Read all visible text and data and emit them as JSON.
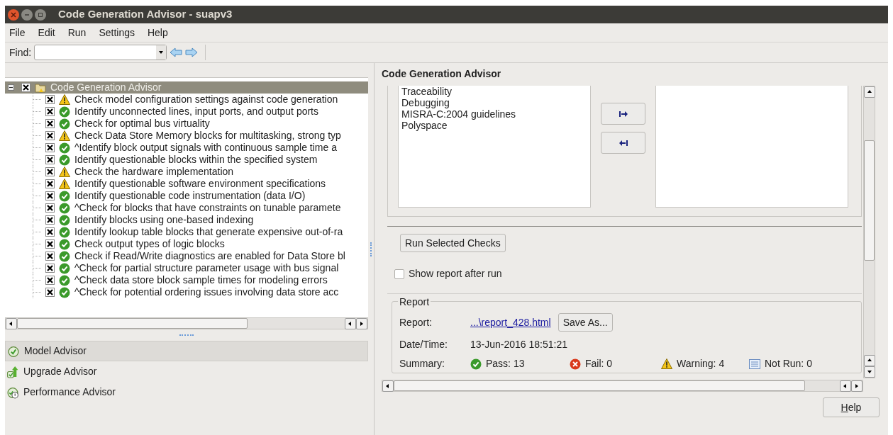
{
  "window": {
    "title": "Code Generation Advisor - suapv3"
  },
  "menu": [
    "File",
    "Edit",
    "Run",
    "Settings",
    "Help"
  ],
  "find": {
    "label": "Find:"
  },
  "tree": {
    "label": "Code Generation Advisor",
    "expanded": true,
    "checked": true,
    "selected": true,
    "children": [
      {
        "label": "Check model configuration settings against code generation",
        "kind": "warning",
        "checked": true
      },
      {
        "label": "Identify unconnected lines, input ports, and output ports",
        "kind": "pass",
        "checked": true
      },
      {
        "label": "Check for optimal bus virtuality",
        "kind": "pass",
        "checked": true
      },
      {
        "label": "Check Data Store Memory blocks for multitasking, strong typ",
        "kind": "warning",
        "checked": true
      },
      {
        "label": "^Identify block output signals with continuous sample time a",
        "kind": "pass",
        "checked": true
      },
      {
        "label": "Identify questionable blocks within the specified system",
        "kind": "pass",
        "checked": true
      },
      {
        "label": "Check the hardware implementation",
        "kind": "warning",
        "checked": true
      },
      {
        "label": "Identify questionable software environment specifications",
        "kind": "warning",
        "checked": true
      },
      {
        "label": "Identify questionable code instrumentation (data I/O)",
        "kind": "pass",
        "checked": true
      },
      {
        "label": "^Check for blocks that have constraints on tunable paramete",
        "kind": "pass",
        "checked": true
      },
      {
        "label": "Identify blocks using one-based indexing",
        "kind": "pass",
        "checked": true
      },
      {
        "label": "Identify lookup table blocks that generate expensive out-of-ra",
        "kind": "pass",
        "checked": true
      },
      {
        "label": "Check output types of logic blocks",
        "kind": "pass",
        "checked": true
      },
      {
        "label": "Check if Read/Write diagnostics are enabled for Data Store bl",
        "kind": "pass",
        "checked": true
      },
      {
        "label": "^Check for partial structure parameter usage with bus signal",
        "kind": "pass",
        "checked": true
      },
      {
        "label": "^Check data store block sample times for modeling errors",
        "kind": "pass",
        "checked": true
      },
      {
        "label": "^Check for potential ordering issues involving data store acc",
        "kind": "pass",
        "checked": true
      }
    ]
  },
  "advisors": [
    {
      "label": "Model Advisor",
      "kind": "model",
      "selected": true
    },
    {
      "label": "Upgrade Advisor",
      "kind": "upgrade",
      "selected": false
    },
    {
      "label": "Performance Advisor",
      "kind": "performance",
      "selected": false
    }
  ],
  "panel": {
    "title": "Code Generation Advisor",
    "available": [
      "Traceability",
      "Debugging",
      "MISRA-C:2004 guidelines",
      "Polyspace"
    ],
    "run_button": "Run Selected Checks",
    "show_report": {
      "label": "Show report after run",
      "checked": false
    },
    "report": {
      "group": "Report",
      "report_label": "Report:",
      "report_link": "...\\report_428.html",
      "save_as": "Save As...",
      "date_label": "Date/Time:",
      "date": "13-Jun-2016 18:51:21",
      "summary_label": "Summary:",
      "summary": [
        {
          "kind": "pass",
          "label": "Pass: 13"
        },
        {
          "kind": "fail",
          "label": "Fail: 0"
        },
        {
          "kind": "warning",
          "label": "Warning: 4"
        },
        {
          "kind": "notrun",
          "label": "Not Run: 0"
        }
      ]
    }
  },
  "help_button": "Help"
}
